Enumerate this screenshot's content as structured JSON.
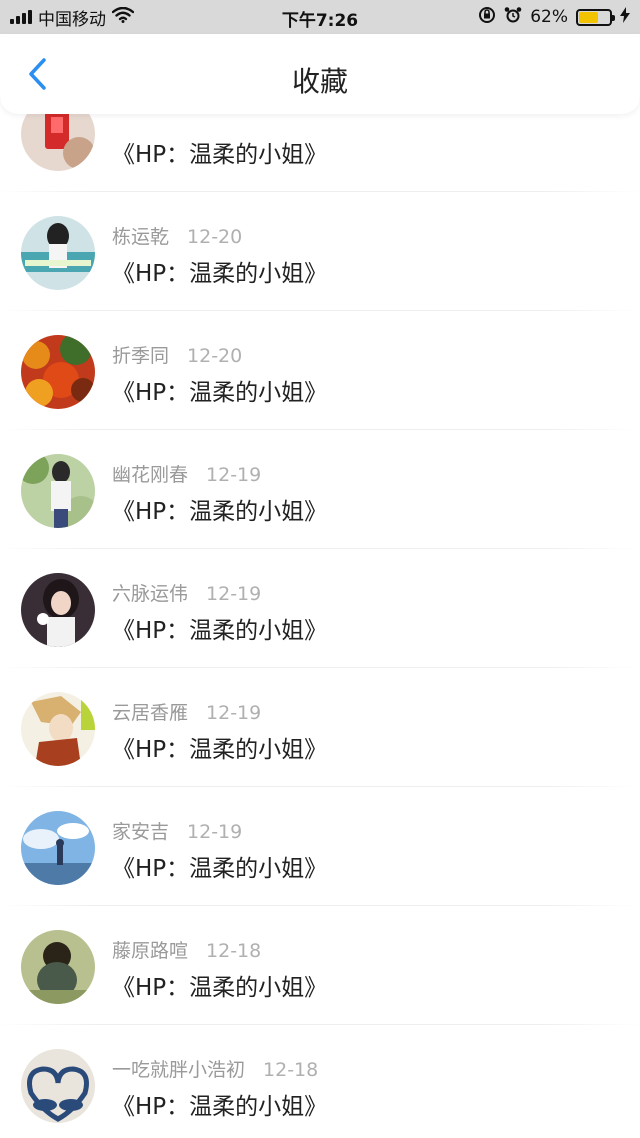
{
  "status_bar": {
    "carrier": "中国移动",
    "time": "下午7:26",
    "battery_percent": "62%",
    "battery_level": 0.62,
    "icons": [
      "signal-icon",
      "wifi-icon",
      "rotation-lock-icon",
      "alarm-icon",
      "battery-icon",
      "charging-icon"
    ]
  },
  "header": {
    "title": "收藏",
    "back_icon": "chevron-left-icon",
    "accent_color": "#2b8ff2"
  },
  "items": [
    {
      "name": "",
      "date": "",
      "title": "《HP：温柔的小姐》"
    },
    {
      "name": "栋运乾",
      "date": "12-20",
      "title": "《HP：温柔的小姐》"
    },
    {
      "name": "折季同",
      "date": "12-20",
      "title": "《HP：温柔的小姐》"
    },
    {
      "name": "幽花刚春",
      "date": "12-19",
      "title": "《HP：温柔的小姐》"
    },
    {
      "name": "六脉运伟",
      "date": "12-19",
      "title": "《HP：温柔的小姐》"
    },
    {
      "name": "云居香雁",
      "date": "12-19",
      "title": "《HP：温柔的小姐》"
    },
    {
      "name": "家安吉",
      "date": "12-19",
      "title": "《HP：温柔的小姐》"
    },
    {
      "name": "藤原路喧",
      "date": "12-18",
      "title": "《HP：温柔的小姐》"
    },
    {
      "name": "一吃就胖小浩初",
      "date": "12-18",
      "title": "《HP：温柔的小姐》"
    }
  ]
}
